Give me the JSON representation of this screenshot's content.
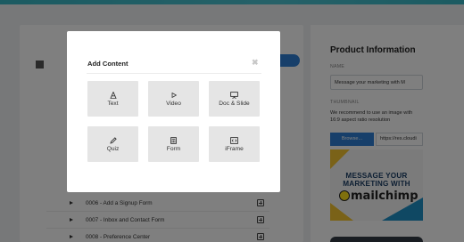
{
  "modal": {
    "title": "Add Content",
    "close_glyph": "✖",
    "tiles": [
      {
        "label": "Text",
        "icon": "text-icon"
      },
      {
        "label": "Video",
        "icon": "play-icon"
      },
      {
        "label": "Doc & Slide",
        "icon": "presentation-icon"
      },
      {
        "label": "Quiz",
        "icon": "pencil-icon"
      },
      {
        "label": "Form",
        "icon": "calculator-icon"
      },
      {
        "label": "iFrame",
        "icon": "embed-icon"
      }
    ]
  },
  "lessons": [
    {
      "title": "0006 - Add a Signup Form"
    },
    {
      "title": "0007 - Inbox and Contact Form"
    },
    {
      "title": "0008 - Preference Center"
    }
  ],
  "side_panel": {
    "title": "Product Information",
    "name_label": "NAME",
    "name_value": "Message your marketing with M",
    "thumbnail_label": "THUMBNAIL",
    "thumbnail_note": "We recommend to use an image with 16:9 aspect ratio resolution",
    "browse_label": "Browse...",
    "url_value": "https://res.cloudi",
    "thumb_line1": "MESSAGE YOUR",
    "thumb_line2": "MARKETING WITH",
    "thumb_brand": "mailchimp"
  },
  "colors": {
    "accent_blue": "#2f7fd4",
    "top_bar": "#37b6c4",
    "tile_bg": "#e5e5e5"
  }
}
